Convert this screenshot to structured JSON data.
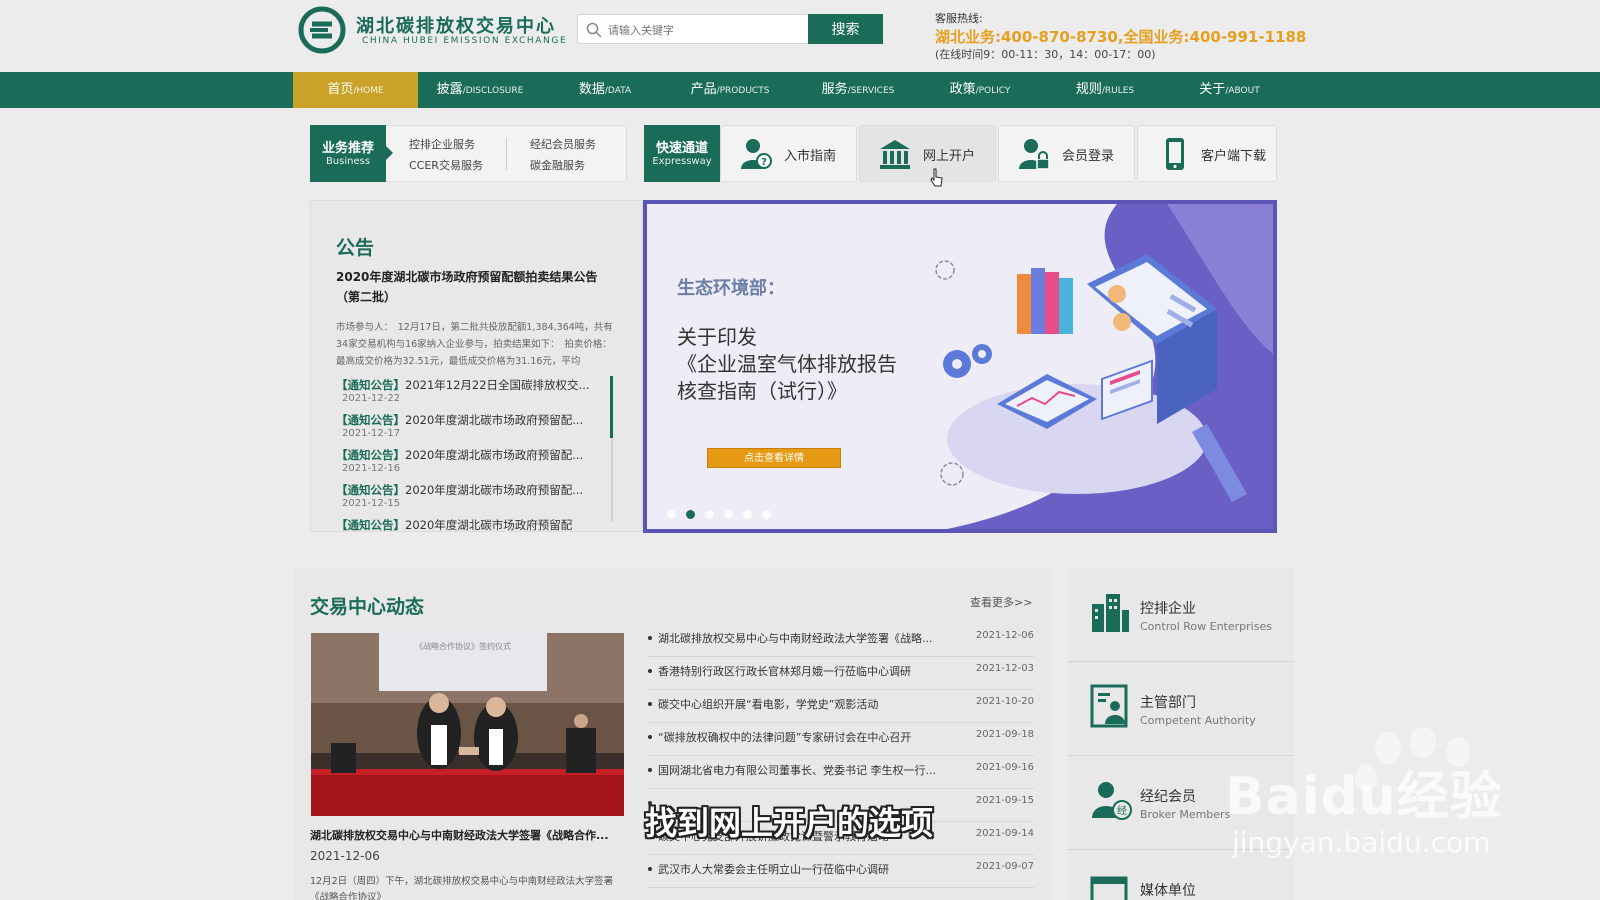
{
  "header": {
    "logo_cn": "湖北碳排放权交易中心",
    "logo_en": "CHINA HUBEI EMISSION EXCHANGE",
    "search_placeholder": "请输入关键字",
    "search_button": "搜索",
    "hotline_label": "客服热线:",
    "hotline_numbers": "湖北业务:400-870-8730,全国业务:400-991-1188",
    "hotline_hours": "(在线时间9：00-11：30，14：00-17：00)"
  },
  "nav": [
    {
      "cn": "首页",
      "en": "/HOME",
      "active": true
    },
    {
      "cn": "披露",
      "en": "/DISCLOSURE"
    },
    {
      "cn": "数据",
      "en": "/DATA"
    },
    {
      "cn": "产品",
      "en": "/PRODUCTS"
    },
    {
      "cn": "服务",
      "en": "/SERVICES"
    },
    {
      "cn": "政策",
      "en": "/POLICY"
    },
    {
      "cn": "规则",
      "en": "/RULES"
    },
    {
      "cn": "关于",
      "en": "/ABOUT"
    }
  ],
  "business": {
    "tag_cn": "业务推荐",
    "tag_en": "Business",
    "links": [
      "控排企业服务",
      "经纪会员服务",
      "CCER交易服务",
      "碳金融服务"
    ]
  },
  "express": {
    "tag_cn": "快速通道",
    "tag_en": "Expressway",
    "buttons": [
      {
        "label": "入市指南",
        "icon": "user-question-icon"
      },
      {
        "label": "网上开户",
        "icon": "bank-icon"
      },
      {
        "label": "会员登录",
        "icon": "user-lock-icon"
      },
      {
        "label": "客户端下载",
        "icon": "mobile-icon"
      }
    ]
  },
  "notice": {
    "title": "公告",
    "headline": "2020年度湖北碳市场政府预留配额拍卖结果公告（第二批）",
    "excerpt": "市场参与人：　12月17日，第二批共投放配额1,384,364吨，共有34家交易机构与16家纳入企业参与，拍卖结果如下：　拍卖价格：最高成交价格为32.51元，最低成交价格为31.16元，平均",
    "items": [
      {
        "tag": "【通知公告】",
        "title": "2021年12月22日全国碳排放权交...",
        "date": "2021-12-22"
      },
      {
        "tag": "【通知公告】",
        "title": "2020年度湖北碳市场政府预留配...",
        "date": "2021-12-17"
      },
      {
        "tag": "【通知公告】",
        "title": "2020年度湖北碳市场政府预留配...",
        "date": "2021-12-16"
      },
      {
        "tag": "【通知公告】",
        "title": "2020年度湖北碳市场政府预留配...",
        "date": "2021-12-15"
      },
      {
        "tag": "【通知公告】",
        "title": "2020年度湖北碳市场政府预留配",
        "date": ""
      }
    ]
  },
  "banner": {
    "subtitle": "生态环境部：",
    "headline_lines": [
      "关于印发",
      "《企业温室气体排放报告",
      "核查指南（试行）》"
    ],
    "button": "点击查看详情",
    "dots": 6,
    "active_dot": 1
  },
  "news": {
    "title": "交易中心动态",
    "more": "查看更多>>",
    "photo_caption": "《战略合作协议》签约仪式",
    "feature_title": "湖北碳排放权交易中心与中南财经政法大学签署《战略合作...",
    "feature_date": "2021-12-06",
    "feature_excerpt": "12月2日（周四）下午，湖北碳排放权交易中心与中南财经政法大学签署《战略合作协议》",
    "rows": [
      {
        "title": "湖北碳排放权交易中心与中南财经政法大学签署《战略...",
        "date": "2021-12-06"
      },
      {
        "title": "香港特别行政区行政长官林郑月娥一行莅临中心调研",
        "date": "2021-12-03"
      },
      {
        "title": "碳交中心组织开展“看电影，学党史”观影活动",
        "date": "2021-10-20"
      },
      {
        "title": "“碳排放权确权中的法律问题”专家研讨会在中心召开",
        "date": "2021-09-18"
      },
      {
        "title": "国网湖北省电力有限公司董事长、党委书记 李生权一行...",
        "date": "2021-09-16"
      },
      {
        "title": "",
        "date": "2021-09-15"
      },
      {
        "title": "碳交中心党支部开展讲廉政党课暨警示教育活动",
        "date": "2021-09-14"
      },
      {
        "title": "武汉市人大常委会主任明立山一行莅临中心调研",
        "date": "2021-09-07"
      }
    ]
  },
  "sidebar": [
    {
      "cn": "控排企业",
      "en": "Control Row Enterprises",
      "icon": "building-icon"
    },
    {
      "cn": "主管部门",
      "en": "Competent Authority",
      "icon": "id-card-icon"
    },
    {
      "cn": "经纪会员",
      "en": "Broker Members",
      "icon": "broker-icon"
    },
    {
      "cn": "媒体单位",
      "en": "",
      "icon": "media-icon"
    }
  ],
  "overlay": {
    "subtitle": "找到网上开户的选项",
    "watermark_brand": "Baidu经验",
    "watermark_url": "jingyan.baidu.com"
  },
  "colors": {
    "primary": "#1a6b57",
    "gold": "#c9a227",
    "hotline": "#e6a020",
    "banner_border": "#5b55b5",
    "banner_button": "#e69a14"
  }
}
